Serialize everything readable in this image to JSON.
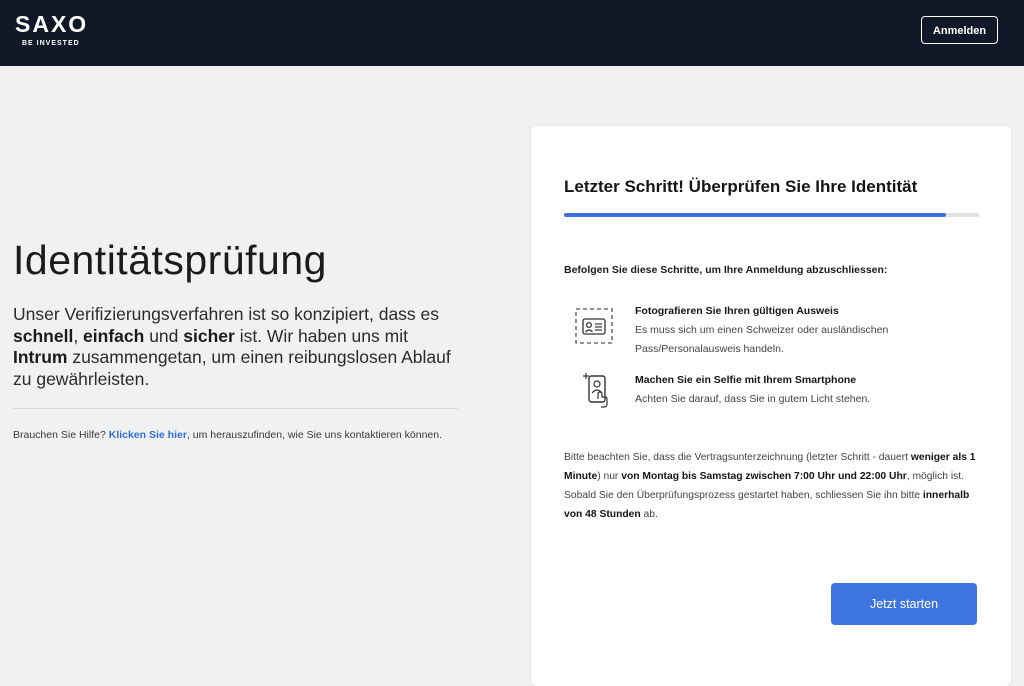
{
  "header": {
    "logo_text": "SAXO",
    "logo_tagline": "BE INVESTED",
    "login_label": "Anmelden"
  },
  "left": {
    "title": "Identitätsprüfung",
    "intro": {
      "p1": "Unser Verifizierungsverfahren ist so konzipiert, dass es ",
      "b1": "schnell",
      "p2": ", ",
      "b2": "einfach",
      "p3": " und ",
      "b3": "sicher",
      "p4": " ist. Wir haben uns mit ",
      "b4": "Intrum",
      "p5": " zusammengetan, um einen reibungslosen Ablauf zu gewährleisten."
    },
    "help": {
      "prefix": "Brauchen Sie Hilfe? ",
      "link": "Klicken Sie hier",
      "suffix": ", um herauszufinden, wie Sie uns kontaktieren können."
    }
  },
  "card": {
    "title": "Letzter Schritt! Überprüfen Sie Ihre Identität",
    "progress": 0.92,
    "steps_intro": "Befolgen Sie diese Schritte, um Ihre Anmeldung abzuschliessen:",
    "steps": [
      {
        "icon": "id-card-icon",
        "title": "Fotografieren Sie Ihren gültigen Ausweis",
        "line1": "Es muss sich um einen Schweizer oder ausländischen",
        "line2": "Pass/Personalausweis handeln."
      },
      {
        "icon": "selfie-phone-icon",
        "title": "Machen Sie ein Selfie mit Ihrem Smartphone",
        "line1": "Achten Sie darauf, dass Sie in gutem Licht stehen."
      }
    ],
    "notice": {
      "t1": "Bitte beachten Sie, dass die Vertragsunterzeichnung (letzter Schritt - dauert ",
      "b1": "weniger als 1 Minute",
      "t2": ") nur ",
      "b2": "von Montag bis Samstag zwischen 7:00 Uhr und 22:00 Uhr",
      "t3": ", möglich ist. Sobald Sie den Überprüfungsprozess gestartet haben, schliessen Sie ihn bitte ",
      "b3": "innerhalb von 48 Stunden",
      "t4": " ab."
    },
    "start_label": "Jetzt starten"
  },
  "colors": {
    "header_bg": "#111827",
    "accent": "#3e74e0",
    "link": "#2f6fdc",
    "page_bg": "#f1f1f1"
  }
}
